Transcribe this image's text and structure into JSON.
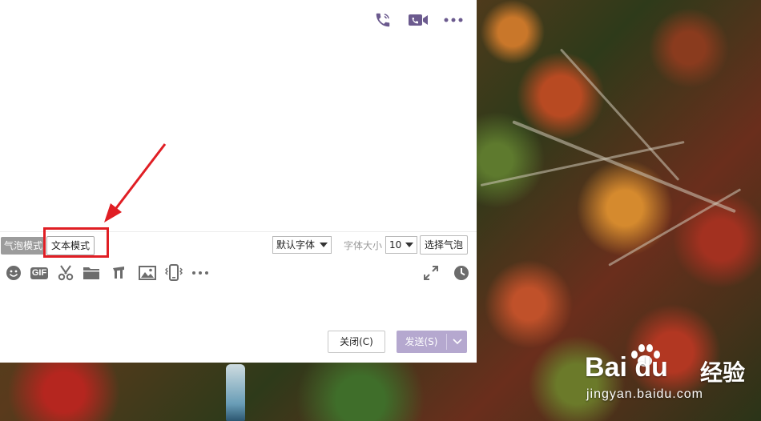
{
  "window": {
    "top_actions": [
      {
        "name": "voice-call",
        "icon": "phone-icon"
      },
      {
        "name": "video-call",
        "icon": "video-camera-icon"
      },
      {
        "name": "more",
        "icon": "ellipsis-icon"
      }
    ]
  },
  "format_bar": {
    "bubble_mode_label": "气泡模式",
    "text_mode_label": "文本模式",
    "font_value": "默认字体",
    "font_size_label": "字体大小",
    "font_size_value": "10",
    "select_bubble_label": "选择气泡"
  },
  "toolbar": {
    "gif_label": "GIF",
    "items": [
      "emoji-icon",
      "gif-icon",
      "scissors-icon",
      "folder-icon",
      "music-note-icon",
      "image-icon",
      "shake-icon",
      "ellipsis-icon",
      "expand-icon",
      "clock-icon"
    ]
  },
  "footer": {
    "close_label": "关闭(C)",
    "send_label": "发送(S)"
  },
  "watermark": {
    "logo_text": "Bai du",
    "cn_text": "经验",
    "url": "jingyan.baidu.com"
  },
  "colors": {
    "accent": "#6b5a8e",
    "send_button": "#b5a8cf",
    "highlight": "#e01e24"
  }
}
